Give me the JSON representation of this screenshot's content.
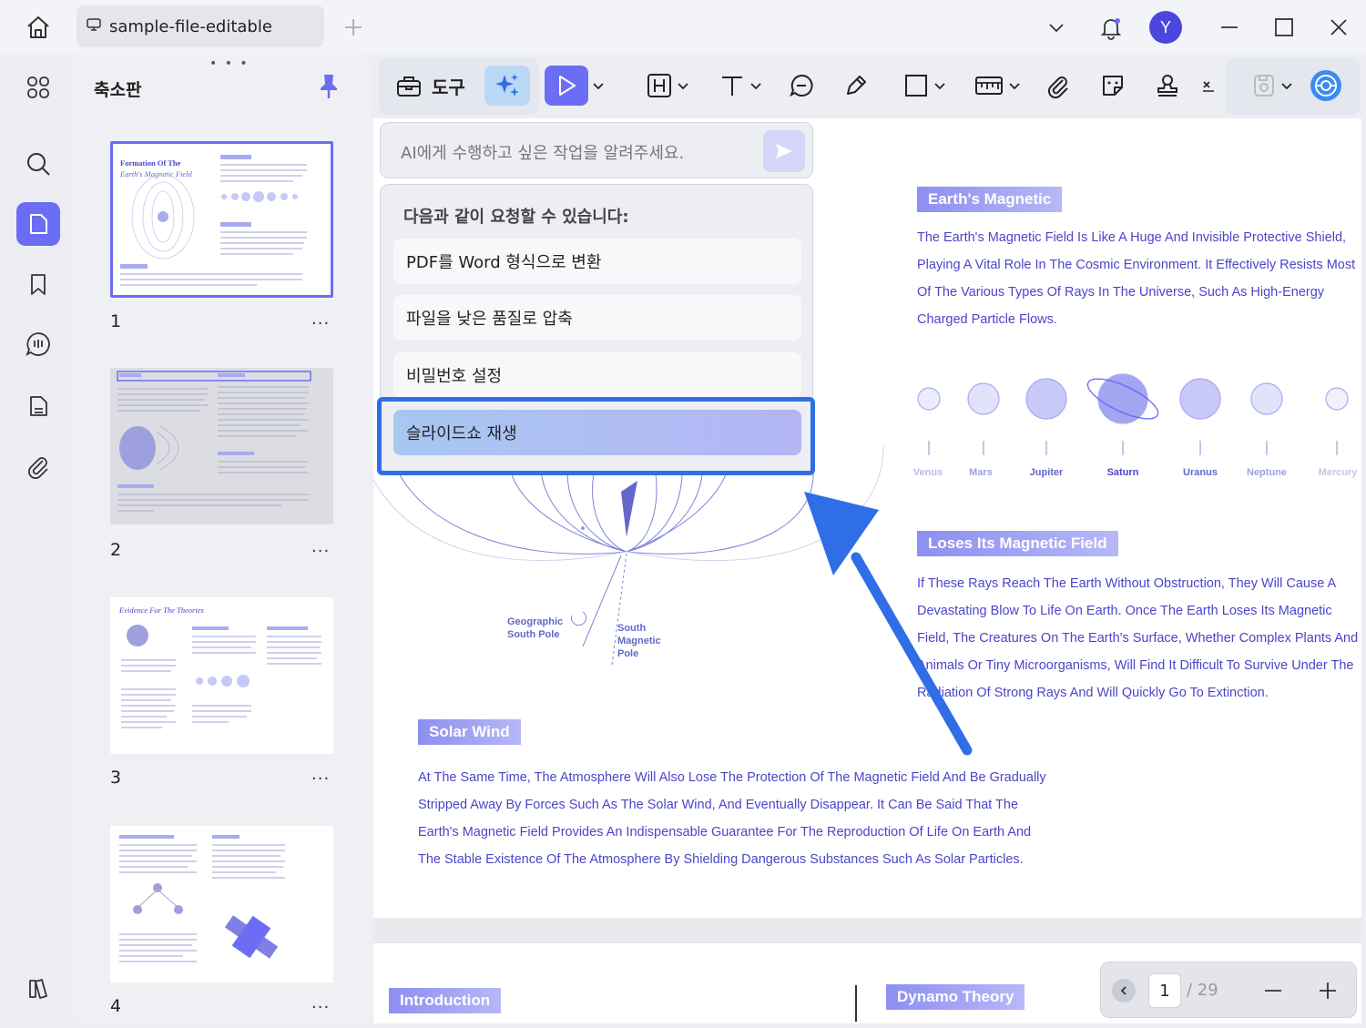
{
  "titlebar": {
    "tab_title": "sample-file-editable",
    "avatar_initial": "Y"
  },
  "thumbnails": {
    "title": "축소판",
    "items": [
      {
        "page": "1",
        "more": "..."
      },
      {
        "page": "2",
        "more": "..."
      },
      {
        "page": "3",
        "more": "..."
      },
      {
        "page": "4",
        "more": "..."
      }
    ],
    "mini_titles": {
      "t1_line1": "Formation Of The",
      "t1_line2": "Earth's Magnetic Field",
      "t3": "Evidence For The Theories"
    }
  },
  "toolbar": {
    "tools_label": "도구",
    "colors": {
      "accent": "#6c6df5",
      "ai_button": "#b9d8f5"
    }
  },
  "ai": {
    "placeholder": "AI에게 수행하고 싶은 작업을 알려주세요.",
    "panel_title": "다음과 같이 요청할 수 있습니다:",
    "options": [
      "PDF를 Word 형식으로 변환",
      "파일을 낮은 품질로 압축",
      "비밀번호 설정",
      "슬라이드쇼 재생"
    ]
  },
  "document": {
    "heading1": "Earth's Magnetic",
    "para1": [
      "The Earth's Magnetic Field Is Like A Huge And Invisible Protective Shield,",
      "Playing A Vital Role In The Cosmic Environment. It Effectively Resists Most",
      "Of The Various Types Of Rays In The Universe, Such As High-Energy",
      "Charged Particle Flows."
    ],
    "planets": [
      "Venus",
      "Mars",
      "Jupiter",
      "Saturn",
      "Uranus",
      "Neptune",
      "Mercury"
    ],
    "heading2": "Loses Its Magnetic Field",
    "para2": [
      "If These Rays Reach The Earth Without Obstruction, They Will Cause A",
      "Devastating Blow To Life On Earth. Once The Earth Loses Its Magnetic",
      "Field, The Creatures On The Earth's Surface, Whether Complex Plants And",
      "Animals Or Tiny Microorganisms, Will Find It Difficult To Survive Under The",
      "Radiation Of Strong Rays And Will Quickly Go To Extinction."
    ],
    "diagram_labels": {
      "geo_line1": "Geographic",
      "geo_line2": "South Pole",
      "mag_line1": "South",
      "mag_line2": "Magnetic",
      "mag_line3": "Pole"
    },
    "heading3": "Solar Wind",
    "para3": [
      "At The Same Time, The Atmosphere Will Also Lose The Protection Of The Magnetic Field And Be Gradually",
      "Stripped Away By Forces Such As The Solar Wind, And Eventually Disappear. It Can Be Said That The",
      "Earth's Magnetic Field Provides An Indispensable Guarantee For The Reproduction Of Life On Earth And",
      "The Stable Existence Of The Atmosphere By Shielding Dangerous Substances Such As Solar Particles."
    ],
    "page2_heading_left": "Introduction",
    "page2_heading_right": "Dynamo Theory"
  },
  "pager": {
    "current": "1",
    "total": "/ 29"
  }
}
